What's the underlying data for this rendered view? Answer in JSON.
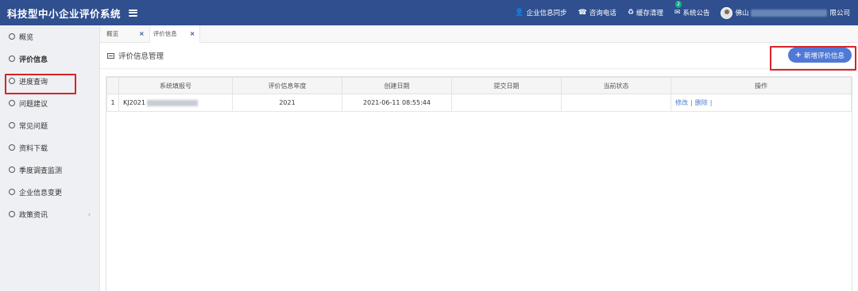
{
  "header": {
    "title": "科技型中小企业评价系统",
    "items": [
      {
        "icon": "user-icon",
        "glyph": "👤",
        "label": "企业信息同步"
      },
      {
        "icon": "phone-icon",
        "glyph": "☎",
        "label": "咨询电话"
      },
      {
        "icon": "recycle-icon",
        "glyph": "♻",
        "label": "缓存清理"
      },
      {
        "icon": "mail-icon",
        "glyph": "✉",
        "label": "系统公告",
        "badge": "2"
      }
    ],
    "user": {
      "prefix": "佛山",
      "suffix": "限公司"
    }
  },
  "sidebar": {
    "items": [
      {
        "label": "概览"
      },
      {
        "label": "评价信息"
      },
      {
        "label": "进度查询"
      },
      {
        "label": "问题建议"
      },
      {
        "label": "常见问题"
      },
      {
        "label": "资料下载"
      },
      {
        "label": "季度调查监测"
      },
      {
        "label": "企业信息变更"
      },
      {
        "label": "政策资讯",
        "chevron": "‹"
      }
    ]
  },
  "tabs": [
    {
      "label": "概览"
    },
    {
      "label": "评价信息"
    }
  ],
  "panel": {
    "title": "评价信息管理",
    "add_button": "新增评价信息"
  },
  "table": {
    "columns": [
      "",
      "系统填报号",
      "评价信息年度",
      "创建日期",
      "提交日期",
      "当前状态",
      "操作"
    ],
    "rows": [
      {
        "index": "1",
        "report_no": "KJ2021",
        "year": "2021",
        "created": "2021-06-11 08:55:44",
        "submitted": "",
        "status": "",
        "actions": [
          "修改",
          "删除"
        ]
      }
    ]
  },
  "colors": {
    "header_bg": "#2f4f8f",
    "button_bg": "#5079d6",
    "highlight_border": "#d8232a",
    "link": "#4a7bd0"
  }
}
